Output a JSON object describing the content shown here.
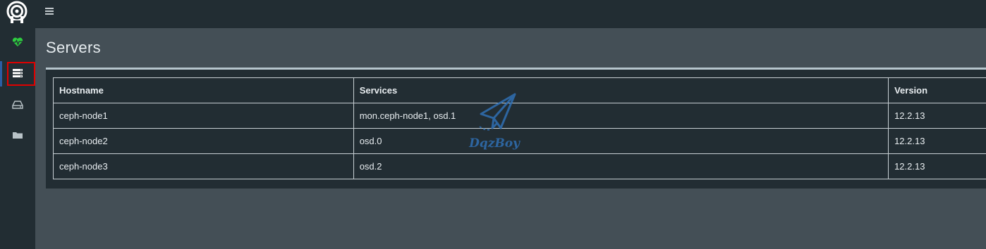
{
  "app": {
    "logo_icon": "ceph-logo-icon",
    "menu_icon": "hamburger-icon"
  },
  "sidebar": {
    "items": [
      {
        "name": "health",
        "icon": "heartbeat-icon",
        "color": "#2ecc40"
      },
      {
        "name": "servers",
        "icon": "server-list-icon",
        "active": true,
        "highlight_color": "#e00000"
      },
      {
        "name": "block",
        "icon": "hard-drive-icon"
      },
      {
        "name": "filesystems",
        "icon": "folder-icon"
      }
    ]
  },
  "page": {
    "title": "Servers"
  },
  "table": {
    "headers": [
      "Hostname",
      "Services",
      "Version"
    ],
    "rows": [
      [
        "ceph-node1",
        "mon.ceph-node1, osd.1",
        "12.2.13"
      ],
      [
        "ceph-node2",
        "osd.0",
        "12.2.13"
      ],
      [
        "ceph-node3",
        "osd.2",
        "12.2.13"
      ]
    ]
  },
  "watermark": {
    "text": "DqzBoy",
    "color": "#2f6fb4"
  }
}
